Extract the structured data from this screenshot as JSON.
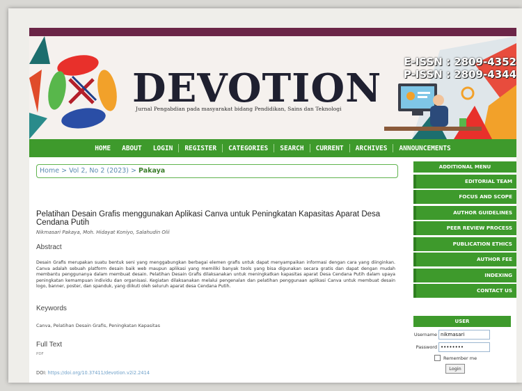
{
  "banner": {
    "title": "DEVOTION",
    "subtitle": "Jurnal Pengabdian pada masyarakat bidang Pendidikan, Sains dan Teknologi",
    "eissn": "E-ISSN : 2809-4352",
    "pissn": "P-ISSN : 2809-4344"
  },
  "nav": [
    "HOME",
    "ABOUT",
    "LOGIN",
    "REGISTER",
    "CATEGORIES",
    "SEARCH",
    "CURRENT",
    "ARCHIVES",
    "ANNOUNCEMENTS"
  ],
  "breadcrumb": {
    "home": "Home",
    "sep1": ">",
    "issue": "Vol 2, No 2 (2023)",
    "sep2": ">",
    "current": "Pakaya"
  },
  "article": {
    "title": "Pelatihan Desain Grafis menggunakan Aplikasi Canva untuk Peningkatan Kapasitas Aparat Desa Cendana Putih",
    "authors": "Nikmasari Pakaya, Moh. Hidayat Koniyo, Salahudin Olii",
    "abstract_heading": "Abstract",
    "abstract": "Desain Grafis merupakan suatu bentuk seni yang menggabungkan berbagai elemen grafis untuk dapat menyampaikan informasi dengan cara yang diinginkan. Canva adalah sebuah platform desain baik web maupun aplikasi yang memiliki banyak tools yang bisa digunakan secara gratis dan dapat dengan mudah membantu penggunanya dalam membuat desain. Pelatihan Desain Grafis dilaksanakan untuk meningkatkan kapasitas aparat Desa Cendana Putih dalam upaya peningkatan kemampuan individu dan organisasi. Kegiatan dilaksanakan melalui pengenalan dan pelatihan penggunaan aplikasi Canva untuk membuat desain logo, banner, poster, dan spanduk, yang diikuti oleh seluruh  aparat desa Cendana Putih.",
    "keywords_heading": "Keywords",
    "keywords": "Canva, Pelatihan Desain Grafis, Peningkatan Kapasitas",
    "fulltext_heading": "Full Text",
    "fulltext_link": "PDF",
    "doi_label": "DOI:",
    "doi_link": "https://doi.org/10.37411/devotion.v2i2.2414"
  },
  "sidebar": {
    "heading": "ADDITIONAL MENU",
    "items": [
      "EDITORIAL TEAM",
      "FOCUS AND SCOPE",
      "AUTHOR GUIDELINES",
      "PEER REVIEW PROCESS",
      "PUBLICATION ETHICS",
      "AUTHOR FEE",
      "INDEXING",
      "CONTACT US"
    ]
  },
  "user": {
    "heading": "USER",
    "username_label": "Username",
    "username_value": "nikmasari",
    "password_label": "Password",
    "password_value": "••••••••",
    "remember_label": "Remember me",
    "login_button": "Login"
  },
  "colors": {
    "nav_green": "#3e9a2c",
    "top_strip": "#6b2547",
    "link_blue": "#5b8ab0"
  }
}
